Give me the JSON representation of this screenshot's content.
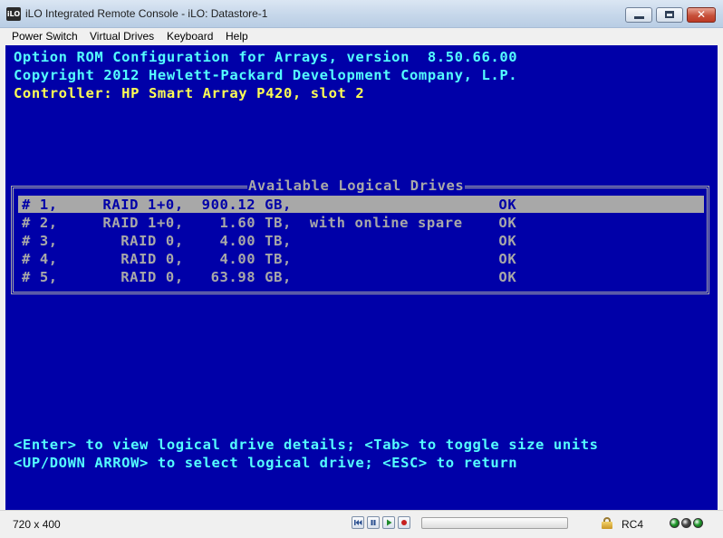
{
  "window": {
    "app_icon_text": "iLO",
    "title": "iLO Integrated Remote Console - iLO: Datastore-1",
    "controls": {
      "minimize_icon": "minimize-icon",
      "maximize_icon": "maximize-icon",
      "close_glyph": "✕"
    }
  },
  "menu": [
    "Power Switch",
    "Virtual Drives",
    "Keyboard",
    "Help"
  ],
  "console": {
    "header_line1": "Option ROM Configuration for Arrays, version  8.50.66.00",
    "header_line2": "Copyright 2012 Hewlett-Packard Development Company, L.P.",
    "header_line3": "Controller: HP Smart Array P420, slot 2",
    "box_title": "Available Logical Drives",
    "drives": [
      {
        "line": "# 1,     RAID 1+0,  900.12 GB,                       OK",
        "selected": true
      },
      {
        "line": "# 2,     RAID 1+0,    1.60 TB,  with online spare    OK",
        "selected": false
      },
      {
        "line": "# 3,       RAID 0,    4.00 TB,                       OK",
        "selected": false
      },
      {
        "line": "# 4,       RAID 0,    4.00 TB,                       OK",
        "selected": false
      },
      {
        "line": "# 5,       RAID 0,   63.98 GB,                       OK",
        "selected": false
      }
    ],
    "footer_line1": "<Enter> to view logical drive details; <Tab> to toggle size units",
    "footer_line2": "<UP/DOWN ARROW> to select logical drive; <ESC> to return",
    "colors": {
      "background": "#0000a8",
      "yellow": "#fefe54",
      "cyan": "#54fefe",
      "gray": "#a8a8a8"
    }
  },
  "status": {
    "resolution": "720 x 400",
    "playback_icons": [
      "skip-start-icon",
      "pause-icon",
      "play-icon",
      "record-icon"
    ],
    "encryption": "RC4",
    "indicator_colors": [
      "#1e9a2a",
      "#4a4a4a",
      "#1e9a2a"
    ]
  }
}
